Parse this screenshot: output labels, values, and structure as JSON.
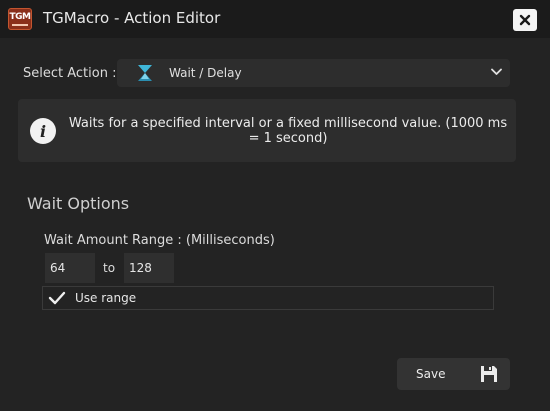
{
  "window": {
    "title": "TGMacro - Action Editor",
    "logo_text": "TGM"
  },
  "action_select": {
    "label": "Select Action :",
    "selected_value": "Wait / Delay",
    "icon": "hourglass-icon"
  },
  "info": {
    "icon": "info-icon",
    "text": "Waits for a specified interval or a fixed millisecond value. (1000 ms = 1 second)"
  },
  "wait_options": {
    "title": "Wait Options",
    "range_label": "Wait Amount Range : (Milliseconds)",
    "min_value": "64",
    "to_label": "to",
    "max_value": "128",
    "use_range_label": "Use range",
    "use_range_checked": true
  },
  "footer": {
    "save_label": "Save",
    "save_icon": "floppy-disk-icon"
  },
  "colors": {
    "window_bg": "#232323",
    "titlebar_bg": "#1b1b1b",
    "panel_bg": "#2d2d2d",
    "accent_cyan": "#3fb6d8"
  }
}
